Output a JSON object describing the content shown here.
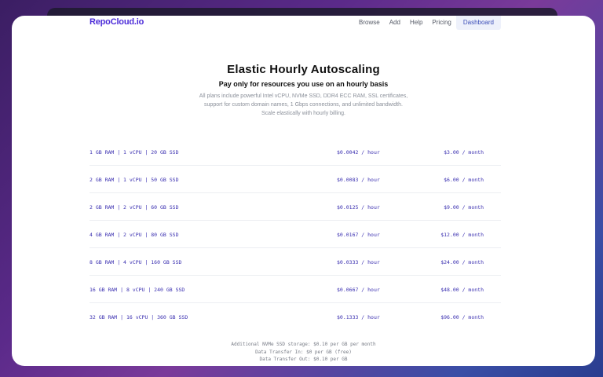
{
  "nav": {
    "logo": "RepoCloud.io",
    "links": [
      "Browse",
      "Add",
      "Help",
      "Pricing",
      "Dashboard"
    ]
  },
  "hero": {
    "title": "Elastic Hourly Autoscaling",
    "subtitle": "Pay only for resources you use on an hourly basis",
    "description": "All plans include powerful Intel vCPU, NVMe SSD, DDR4 ECC RAM, SSL certificates, support for custom domain names, 1 Gbps connections, and unlimited bandwidth. Scale elastically with hourly billing."
  },
  "plans": [
    {
      "spec": "1 GB RAM | 1 vCPU | 20 GB SSD",
      "hourly": "$0.0042 / hour",
      "monthly": "$3.00 / month"
    },
    {
      "spec": "2 GB RAM | 1 vCPU | 50 GB SSD",
      "hourly": "$0.0083 / hour",
      "monthly": "$6.00 / month"
    },
    {
      "spec": "2 GB RAM | 2 vCPU | 60 GB SSD",
      "hourly": "$0.0125 / hour",
      "monthly": "$9.00 / month"
    },
    {
      "spec": "4 GB RAM | 2 vCPU | 80 GB SSD",
      "hourly": "$0.0167 / hour",
      "monthly": "$12.00 / month"
    },
    {
      "spec": "8 GB RAM | 4 vCPU | 160 GB SSD",
      "hourly": "$0.0333 / hour",
      "monthly": "$24.00 / month"
    },
    {
      "spec": "16 GB RAM | 8 vCPU | 240 GB SSD",
      "hourly": "$0.0667 / hour",
      "monthly": "$48.00 / month"
    },
    {
      "spec": "32 GB RAM | 16 vCPU | 360 GB SSD",
      "hourly": "$0.1333 / hour",
      "monthly": "$96.00 / month"
    }
  ],
  "footer_notes": [
    "Additional NVMe SSD storage: $0.10 per GB per month",
    "Data Transfer In: $0 per GB (free)",
    "Data Transfer Out: $0.10 per GB"
  ]
}
